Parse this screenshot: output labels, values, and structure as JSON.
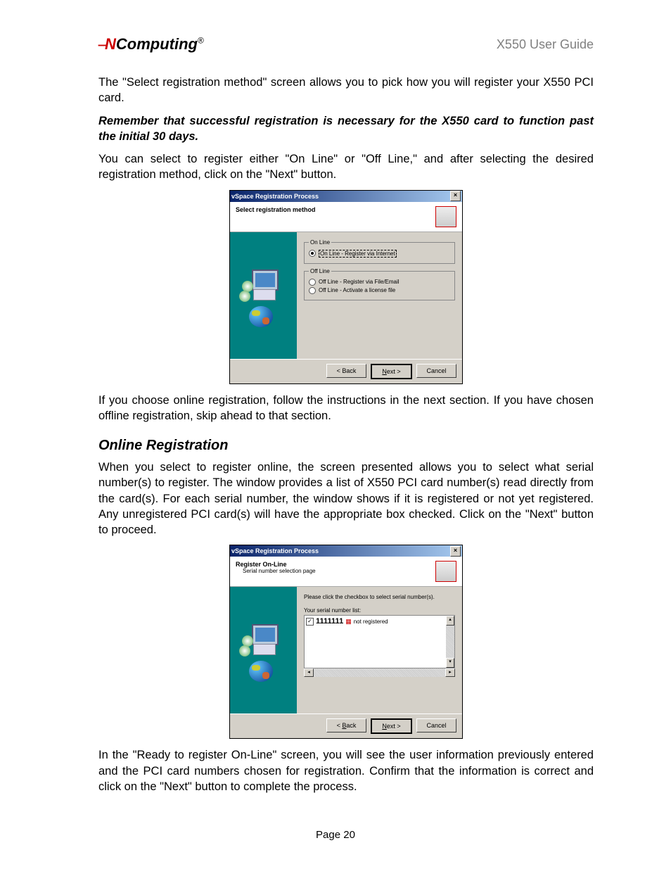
{
  "header": {
    "logo_prefix": "N",
    "logo_rest": "Computing",
    "logo_reg": "®",
    "guide_title": "X550 User Guide"
  },
  "para1": "The \"Select registration method\" screen allows you to pick how you will register your X550 PCI card.",
  "para2_bold": "Remember that successful registration is necessary for the X550 card to function past the initial 30 days.",
  "para3": "You can select to register either \"On Line\" or \"Off Line,\" and after selecting the desired registration method, click on the \"Next\" button.",
  "para4": "If you choose online registration, follow the instructions in the next section.  If you have chosen offline registration, skip ahead to that section.",
  "h_online": "Online Registration",
  "para5": "When you select to register online, the screen presented allows you to select what serial number(s) to register. The window provides a list of X550 PCI card number(s) read directly from the card(s). For each serial number, the window shows if it is registered or not yet registered. Any unregistered PCI card(s) will have the appropriate box checked. Click on the \"Next\" button to proceed.",
  "para6": "In the \"Ready to register On-Line\" screen, you will see the user information previously entered and the PCI card numbers chosen for registration. Confirm that the information is correct and click on the \"Next\" button to complete the process.",
  "footer": "Page 20",
  "dialog1": {
    "title": "vSpace Registration Process",
    "header": "Select registration method",
    "group_online": "On Line",
    "opt_online": "On Line - Register via Internet",
    "group_offline": "Off Line",
    "opt_off1": "Off Line - Register via File/Email",
    "opt_off2": "Off Line - Activate a license file",
    "btn_back": "< Back",
    "btn_next": "Next >",
    "btn_cancel": "Cancel"
  },
  "dialog2": {
    "title": "vSpace Registration Process",
    "header1": "Register On-Line",
    "header2": "Serial number selection page",
    "instr": "Please click the checkbox to select serial number(s).",
    "list_label": "Your serial number list:",
    "serial": "1111111",
    "status": "not registered",
    "btn_back": "< Back",
    "btn_next": "Next >",
    "btn_cancel": "Cancel"
  }
}
